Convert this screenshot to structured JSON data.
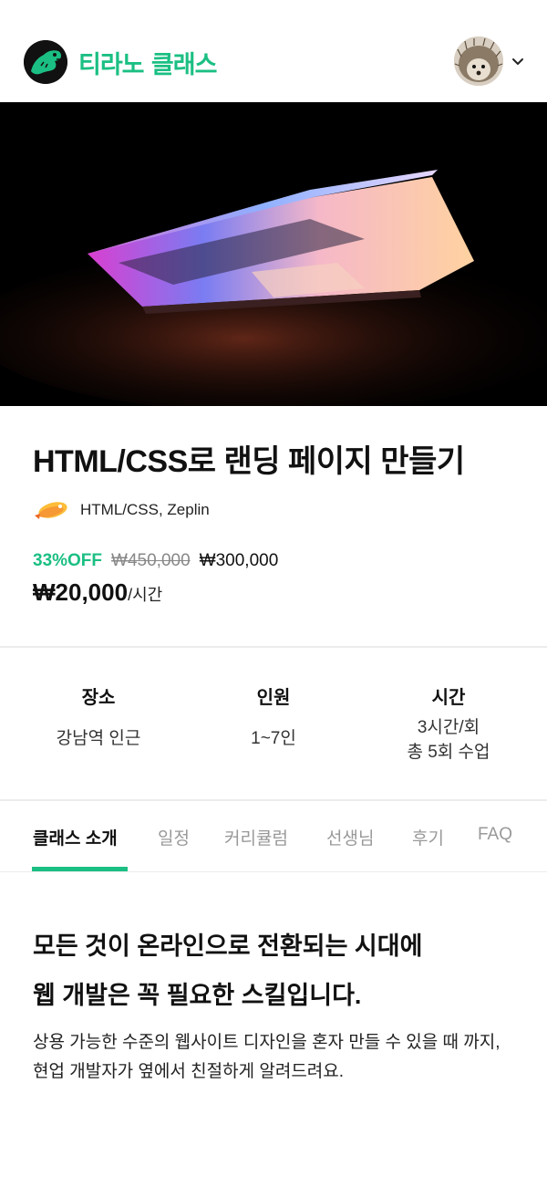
{
  "header": {
    "logo_text": "티라노 클래스",
    "logo_icon": "dinosaur-icon",
    "profile_icon": "avatar-hedgehog",
    "dropdown_icon": "chevron-down-icon"
  },
  "hero": {
    "image": "laptop-photo"
  },
  "class": {
    "title": "HTML/CSS로 랜딩 페이지 만들기",
    "tools_icon": "zeplin-icon",
    "tools": "HTML/CSS, Zeplin",
    "discount": "33%OFF",
    "original_price": "₩450,000",
    "sale_price": "₩300,000",
    "hourly_price": "₩20,000",
    "hourly_unit": "/시간"
  },
  "info": [
    {
      "label": "장소",
      "value": "강남역 인근"
    },
    {
      "label": "인원",
      "value": "1~7인"
    },
    {
      "label": "시간",
      "value_line1": "3시간/회",
      "value_line2": "총 5회 수업"
    }
  ],
  "tabs": [
    {
      "label": "클래스 소개",
      "active": true
    },
    {
      "label": "일정"
    },
    {
      "label": "커리큘럼"
    },
    {
      "label": "선생님"
    },
    {
      "label": "후기"
    },
    {
      "label": "FAQ"
    }
  ],
  "content": {
    "heading_line1": "모든 것이 온라인으로 전환되는 시대에",
    "heading_line2": "웹 개발은 꼭 필요한 스킬입니다.",
    "body": "상용 가능한 수준의 웹사이트 디자인을 혼자 만들 수 있을 때 까지, 현업 개발자가 옆에서 친절하게 알려드려요."
  },
  "colors": {
    "brand": "#1bbf83",
    "text": "#111111",
    "muted": "#999999"
  }
}
